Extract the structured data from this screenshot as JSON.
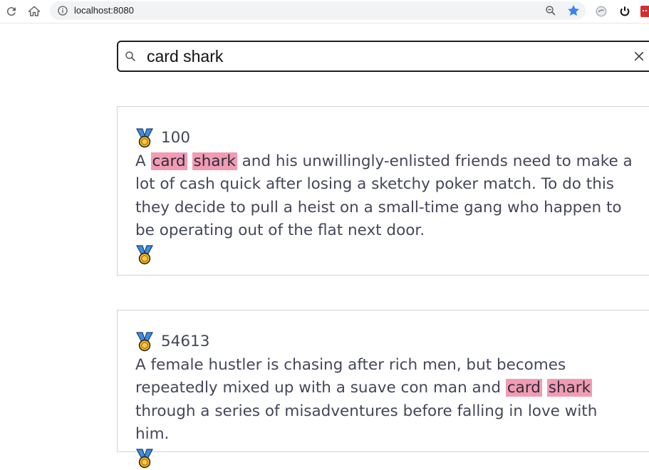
{
  "browser": {
    "url": "localhost:8080",
    "icons": [
      "reload-icon",
      "home-icon",
      "site-info-icon",
      "zoom-icon",
      "bookmark-star-icon",
      "extension-icon",
      "power-icon",
      "extension-red-icon"
    ],
    "star_color": "#3b82f6"
  },
  "search": {
    "query": "card shark",
    "placeholder": ""
  },
  "highlight_color": "#f29bb3",
  "results": [
    {
      "score": "100",
      "description_parts": [
        {
          "text": "A ",
          "hl": false
        },
        {
          "text": "card",
          "hl": true
        },
        {
          "text": " ",
          "hl": false
        },
        {
          "text": "shark",
          "hl": true
        },
        {
          "text": " and his unwillingly-enlisted friends need to make a lot of cash quick after losing a sketchy poker match. To do this they decide to pull a heist on a small-time gang who happen to be operating out of the flat next door.",
          "hl": false
        }
      ]
    },
    {
      "score": "54613",
      "description_parts": [
        {
          "text": "A female hustler is chasing after rich men, but becomes repeatedly mixed up with a suave con man and ",
          "hl": false
        },
        {
          "text": "card",
          "hl": true
        },
        {
          "text": " ",
          "hl": false
        },
        {
          "text": "shark",
          "hl": true
        },
        {
          "text": " through a series of misadventures before falling in love with him.",
          "hl": false
        }
      ]
    }
  ]
}
